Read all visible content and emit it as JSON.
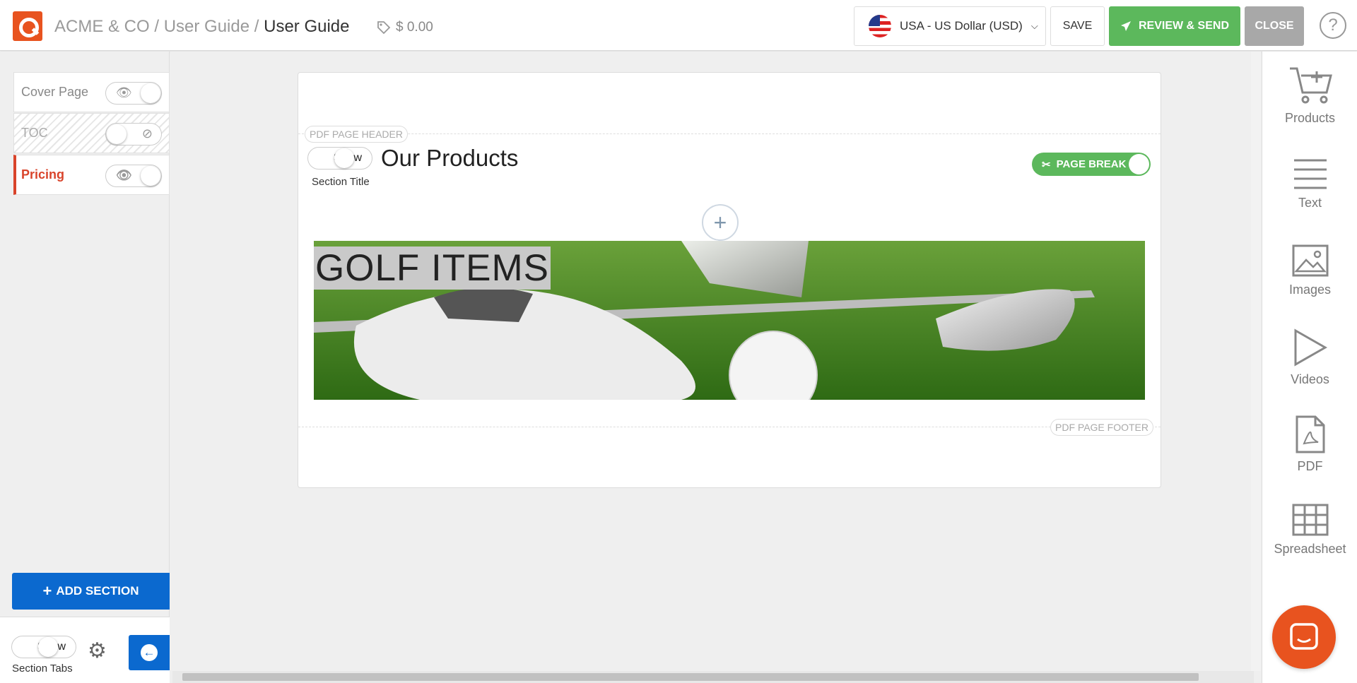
{
  "header": {
    "breadcrumb": [
      "ACME & CO",
      "User Guide",
      "User Guide"
    ],
    "price": "$ 0.00",
    "currency": "USA - US Dollar (USD)",
    "save_label": "SAVE",
    "review_label": "REVIEW & SEND",
    "close_label": "CLOSE",
    "help_symbol": "?"
  },
  "sidebar": {
    "sections": [
      {
        "label": "Cover Page",
        "visible": true,
        "active": false
      },
      {
        "label": "TOC",
        "visible": false,
        "active": false
      },
      {
        "label": "Pricing",
        "visible": true,
        "active": true
      }
    ],
    "add_section_label": "ADD SECTION",
    "show_label": "Show",
    "section_tabs_label": "Section Tabs"
  },
  "editor": {
    "header_label": "PDF PAGE HEADER",
    "footer_label": "PDF PAGE FOOTER",
    "show_label": "Show",
    "section_title_caption": "Section Title",
    "section_title": "Our Products",
    "page_break_label": "PAGE BREAK",
    "banner_title": "GOLF ITEMS"
  },
  "tools": [
    {
      "label": "Products",
      "icon": "cart-icon"
    },
    {
      "label": "Text",
      "icon": "text-lines-icon"
    },
    {
      "label": "Images",
      "icon": "image-icon"
    },
    {
      "label": "Videos",
      "icon": "play-icon"
    },
    {
      "label": "PDF",
      "icon": "pdf-icon"
    },
    {
      "label": "Spreadsheet",
      "icon": "grid-icon"
    }
  ],
  "colors": {
    "brand": "#e8531f",
    "primary": "#0b69cf",
    "success": "#5cb85c",
    "active_section": "#d9442b"
  }
}
